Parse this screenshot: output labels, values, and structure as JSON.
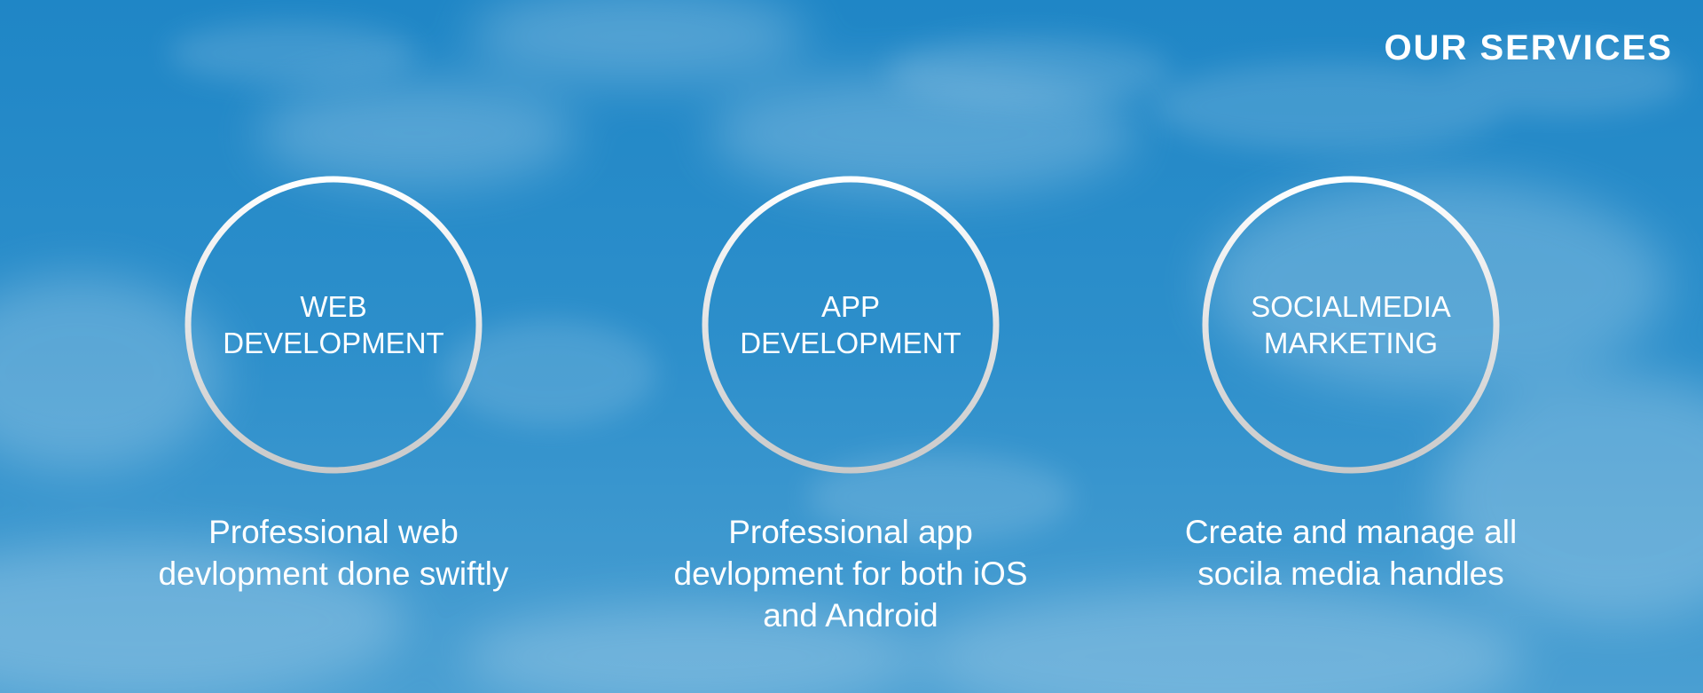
{
  "page": {
    "title": "OUR SERVICES",
    "background": {
      "sky_color": "#2e8ec8",
      "cloud_color": "#ffffff"
    }
  },
  "services": [
    {
      "title_lines": [
        "WEB",
        "DEVELOPMENT"
      ],
      "description_lines": [
        "Professional web",
        "devlopment done  swiftly"
      ]
    },
    {
      "title_lines": [
        "APP",
        "DEVELOPMENT"
      ],
      "description_lines": [
        "Professional app",
        "devlopment for both iOS",
        "and Android"
      ]
    },
    {
      "title_lines": [
        "SOCIALMEDIA",
        "MARKETING"
      ],
      "description_lines": [
        "Create and manage all",
        "socila media handles"
      ]
    }
  ],
  "colors": {
    "text": "#ffffff",
    "ring_top": "#ffffff",
    "ring_bottom": "#c9c9c9"
  }
}
